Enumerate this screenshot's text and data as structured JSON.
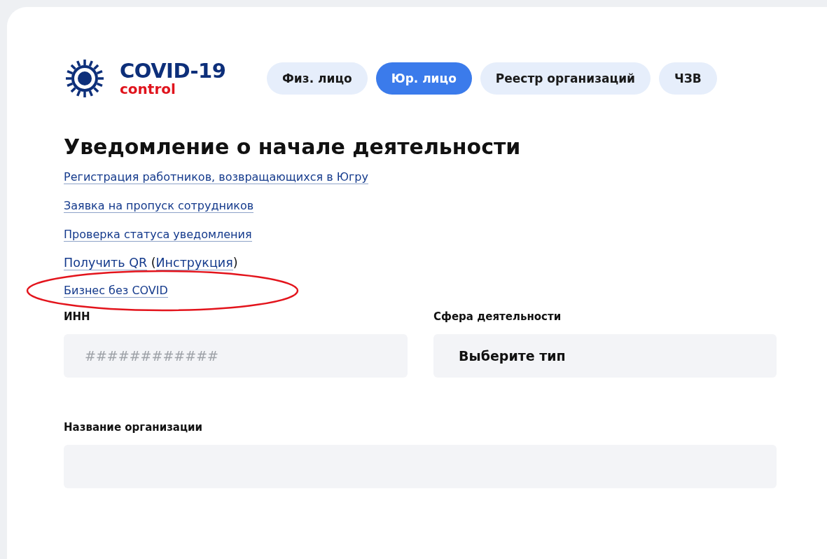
{
  "logo": {
    "title": "COVID-19",
    "subtitle": "control"
  },
  "tabs": [
    {
      "label": "Физ. лицо",
      "selected": false
    },
    {
      "label": "Юр. лицо",
      "selected": true
    },
    {
      "label": "Реестр организаций",
      "selected": false
    },
    {
      "label": "ЧЗВ",
      "selected": false
    }
  ],
  "heading": "Уведомление о начале деятельности",
  "links": [
    {
      "parts": [
        {
          "text": "Регистрация работников, возвращающихся в Югру",
          "link": true
        }
      ],
      "circled": false
    },
    {
      "parts": [
        {
          "text": "Заявка на пропуск сотрудников",
          "link": true
        }
      ],
      "circled": false
    },
    {
      "parts": [
        {
          "text": "Проверка статуса уведомления",
          "link": true
        }
      ],
      "circled": false
    },
    {
      "parts": [
        {
          "text": "Получить QR",
          "link": true
        },
        {
          "text": " (",
          "link": false
        },
        {
          "text": "Инструкция",
          "link": true
        },
        {
          "text": ")",
          "link": false
        }
      ],
      "circled": false
    },
    {
      "parts": [
        {
          "text": "Бизнес без COVID",
          "link": true
        }
      ],
      "circled": true
    }
  ],
  "fields": [
    {
      "label": "ИНН",
      "kind": "input",
      "placeholder": "############"
    },
    {
      "label": "Сфера деятельности",
      "kind": "select",
      "value": "Выберите тип"
    },
    {
      "label": "Название организации",
      "kind": "input",
      "wide": true
    }
  ]
}
